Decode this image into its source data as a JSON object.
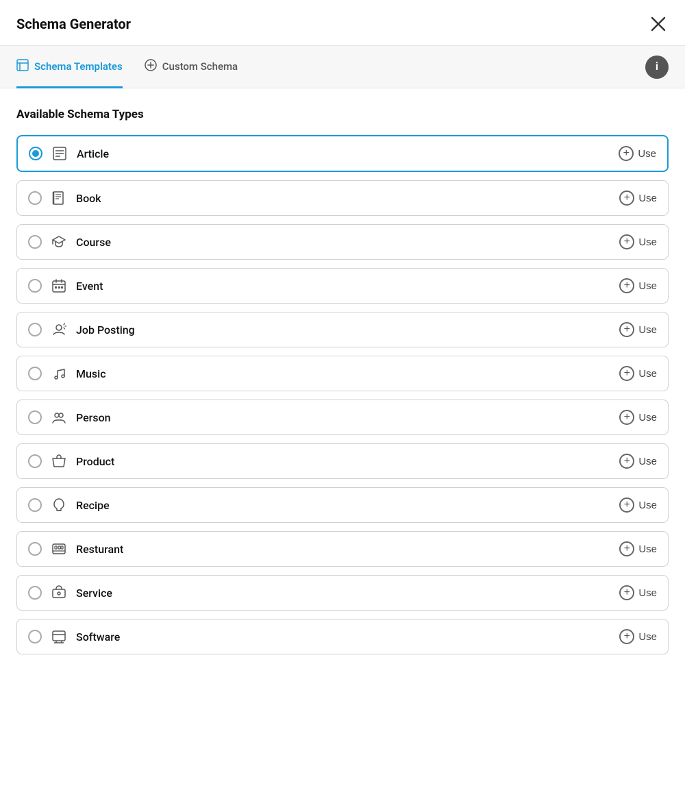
{
  "header": {
    "title": "Schema Generator",
    "close_label": "×"
  },
  "tabs": [
    {
      "id": "schema-templates",
      "label": "Schema Templates",
      "icon": "template-icon",
      "active": true
    },
    {
      "id": "custom-schema",
      "label": "Custom Schema",
      "icon": "plus-icon",
      "active": false
    }
  ],
  "info_button_label": "i",
  "section": {
    "title": "Available Schema Types"
  },
  "schema_types": [
    {
      "id": "article",
      "name": "Article",
      "icon": "article-icon",
      "selected": true,
      "use_label": "Use"
    },
    {
      "id": "book",
      "name": "Book",
      "icon": "book-icon",
      "selected": false,
      "use_label": "Use"
    },
    {
      "id": "course",
      "name": "Course",
      "icon": "course-icon",
      "selected": false,
      "use_label": "Use"
    },
    {
      "id": "event",
      "name": "Event",
      "icon": "event-icon",
      "selected": false,
      "use_label": "Use"
    },
    {
      "id": "job-posting",
      "name": "Job Posting",
      "icon": "job-icon",
      "selected": false,
      "use_label": "Use"
    },
    {
      "id": "music",
      "name": "Music",
      "icon": "music-icon",
      "selected": false,
      "use_label": "Use"
    },
    {
      "id": "person",
      "name": "Person",
      "icon": "person-icon",
      "selected": false,
      "use_label": "Use"
    },
    {
      "id": "product",
      "name": "Product",
      "icon": "product-icon",
      "selected": false,
      "use_label": "Use"
    },
    {
      "id": "recipe",
      "name": "Recipe",
      "icon": "recipe-icon",
      "selected": false,
      "use_label": "Use"
    },
    {
      "id": "restaurant",
      "name": "Resturant",
      "icon": "restaurant-icon",
      "selected": false,
      "use_label": "Use"
    },
    {
      "id": "service",
      "name": "Service",
      "icon": "service-icon",
      "selected": false,
      "use_label": "Use"
    },
    {
      "id": "software",
      "name": "Software",
      "icon": "software-icon",
      "selected": false,
      "use_label": "Use"
    }
  ],
  "colors": {
    "accent": "#1a9ad9",
    "border": "#d0d0d0",
    "text_primary": "#111111",
    "text_secondary": "#555555"
  }
}
